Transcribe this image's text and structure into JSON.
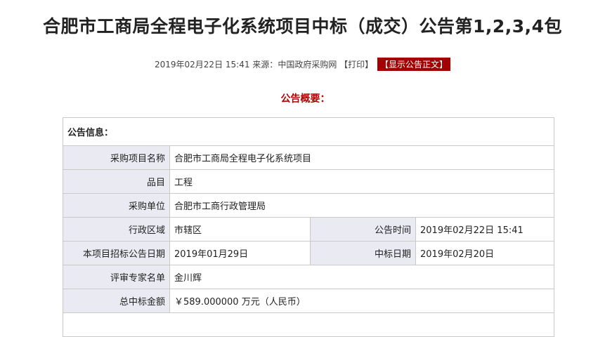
{
  "header": {
    "title": "合肥市工商局全程电子化系统项目中标（成交）公告第1,2,3,4包"
  },
  "meta": {
    "datetime": "2019年02月22日 15:41",
    "source_label": "来源：",
    "source": "中国政府采购网",
    "print_label": "【打印】",
    "show_text_button": "【显示公告正文】"
  },
  "overview_title": "公告概要：",
  "info_table": {
    "section_title": "公告信息：",
    "project_name_label": "采购项目名称",
    "project_name": "合肥市工商局全程电子化系统项目",
    "category_label": "品目",
    "category": "工程",
    "purchaser_label": "采购单位",
    "purchaser": "合肥市工商行政管理局",
    "region_label": "行政区域",
    "region": "市辖区",
    "announce_time_label": "公告时间",
    "announce_time": "2019年02月22日  15:41",
    "bid_notice_date_label": "本项目招标公告日期",
    "bid_notice_date": "2019年01月29日",
    "award_date_label": "中标日期",
    "award_date": "2019年02月20日",
    "experts_label": "评审专家名单",
    "experts": "金川辉",
    "total_amount_label": "总中标金额",
    "total_amount": "￥589.000000 万元（人民币）"
  }
}
